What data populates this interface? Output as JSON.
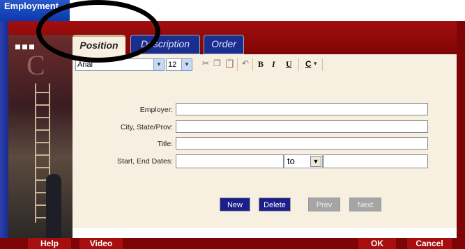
{
  "window": {
    "title": "Employment"
  },
  "tabs": [
    {
      "label": "Position"
    },
    {
      "label": "Description"
    },
    {
      "label": "Order"
    }
  ],
  "toolbar": {
    "font": "Arial",
    "size": "12",
    "bold": "B",
    "italic": "I",
    "underline": "U",
    "color": "C"
  },
  "form": {
    "employer_label": "Employer:",
    "city_label": "City, State/Prov:",
    "title_label": "Title:",
    "dates_label": "Start, End Dates:",
    "to_value": "to"
  },
  "actions": {
    "new": "New",
    "delete": "Delete",
    "prev": "Prev",
    "next": "Next"
  },
  "footer": {
    "help": "Help",
    "video": "Video",
    "ok": "OK",
    "cancel": "Cancel"
  },
  "colors": {
    "frame_red": "#7d0505",
    "tab_blue": "#1a2e8e",
    "content_bg": "#f7efe0",
    "button_navy": "#1b1f8a"
  }
}
